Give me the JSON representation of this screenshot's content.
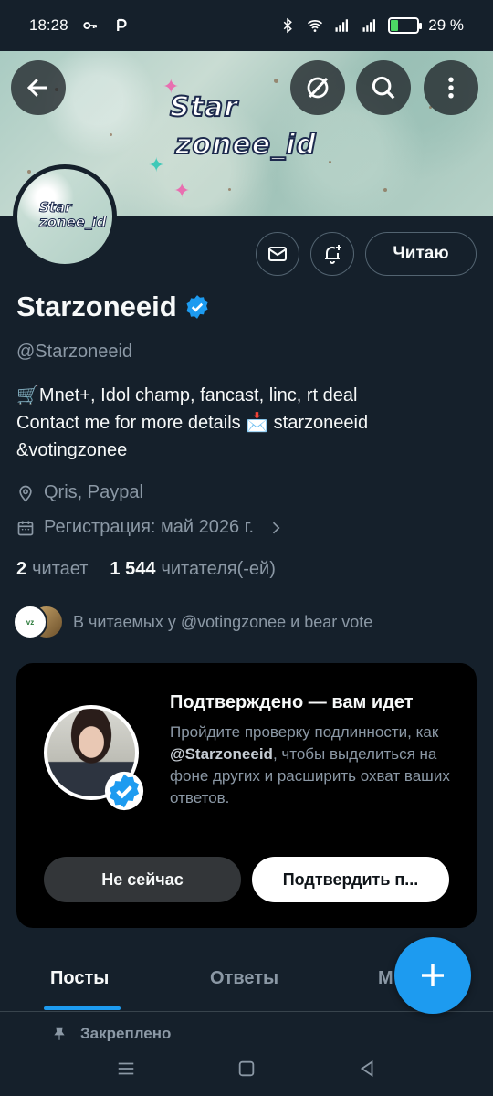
{
  "status_bar": {
    "time": "18:28",
    "battery": "29 %",
    "icons": [
      "key-icon",
      "p-icon",
      "bluetooth-icon",
      "wifi-icon",
      "signal-icon",
      "battery-icon"
    ]
  },
  "banner": {
    "logo_line1": "Star",
    "logo_line2": "zonee_id"
  },
  "avatar": {
    "line1": "Star",
    "line2": "zonee_id"
  },
  "actions": {
    "follow_label": "Читаю"
  },
  "profile": {
    "name": "Starzoneeid",
    "handle": "@Starzoneeid",
    "bio_line1": "🛒Mnet+, Idol champ, fancast, linc, rt deal",
    "bio_line2": "Contact me for more details 📩  starzoneeid",
    "bio_line3": "&votingzonee",
    "location": "Qris, Paypal",
    "joined": "Регистрация: май 2026 г.",
    "following_count": "2",
    "following_label": "читает",
    "followers_count": "1 544",
    "followers_label": "читателя(-ей)",
    "followed_by": "В читаемых у @votingzonee и bear vote"
  },
  "verify_card": {
    "title": "Подтверждено — вам идет",
    "text_before": "Пройдите проверку подлинности, как ",
    "text_handle": "@Starzoneeid",
    "text_after": ", чтобы выделиться на фоне других и расширить охват ваших ответов.",
    "dismiss_label": "Не сейчас",
    "confirm_label": "Подтвердить п..."
  },
  "tabs": [
    {
      "label": "Посты",
      "active": true
    },
    {
      "label": "Ответы",
      "active": false
    },
    {
      "label": "М",
      "active": false
    }
  ],
  "pinned_label": "Закреплено",
  "colors": {
    "background": "#15202b",
    "accent": "#1d9bf0",
    "muted": "#8b98a5",
    "card": "#000000"
  }
}
